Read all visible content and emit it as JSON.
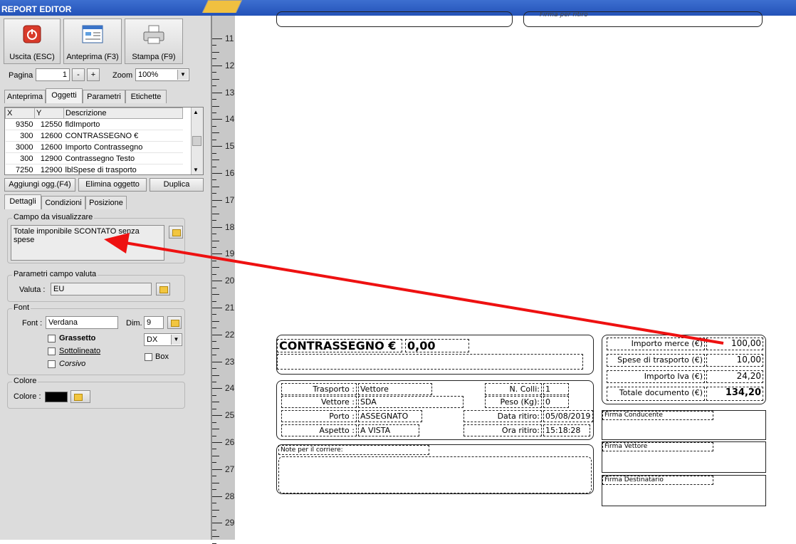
{
  "window": {
    "title": "REPORT EDITOR"
  },
  "toolbar": {
    "exit": "Uscita (ESC)",
    "preview": "Anteprima (F3)",
    "print": "Stampa (F9)"
  },
  "paging": {
    "page_label": "Pagina",
    "page_value": "1",
    "minus": "-",
    "plus": "+",
    "zoom_label": "Zoom",
    "zoom_value": "100%"
  },
  "top_tabs": [
    "Anteprima",
    "Oggetti",
    "Parametri",
    "Etichette"
  ],
  "grid": {
    "headers": [
      "X",
      "Y",
      "Descrizione"
    ],
    "rows": [
      {
        "x": "9350",
        "y": "12550",
        "desc": "fldImporto"
      },
      {
        "x": "300",
        "y": "12600",
        "desc": "CONTRASSEGNO €"
      },
      {
        "x": "3000",
        "y": "12600",
        "desc": "Importo Contrassegno"
      },
      {
        "x": "300",
        "y": "12900",
        "desc": "Contrassegno Testo"
      },
      {
        "x": "7250",
        "y": "12900",
        "desc": "lblSpese di trasporto"
      }
    ]
  },
  "object_buttons": {
    "add": "Aggiungi ogg.(F4)",
    "delete": "Elimina oggetto",
    "duplicate": "Duplica"
  },
  "detail_tabs": [
    "Dettagli",
    "Condizioni",
    "Posizione"
  ],
  "field_group": {
    "title": "Campo da visualizzare",
    "value": "Totale imponibile SCONTATO senza spese"
  },
  "currency_group": {
    "title": "Parametri campo valuta",
    "label": "Valuta :",
    "value": "EU"
  },
  "font_group": {
    "title": "Font",
    "font_label": "Font :",
    "font_value": "Verdana",
    "size_label": "Dim.",
    "size_value": "9",
    "bold": "Grassetto",
    "underline": "Sottolineato",
    "italic": "Corsivo",
    "align_value": "DX",
    "box": "Box"
  },
  "color_group": {
    "title": "Colore",
    "label": "Colore :",
    "value_color": "#000000"
  },
  "ruler": [
    "11",
    "12",
    "13",
    "14",
    "15",
    "16",
    "17",
    "18",
    "19",
    "20",
    "21",
    "22",
    "23",
    "24",
    "25",
    "26",
    "27",
    "28",
    "29"
  ],
  "report": {
    "top_partial": "Firma per ritiro",
    "contrassegno_label": "CONTRASSEGNO €",
    "contrassegno_value": "0,00",
    "totals": [
      {
        "label": "Importo merce (€)",
        "value": "100,00"
      },
      {
        "label": "Spese di trasporto (€)",
        "value": "10,00"
      },
      {
        "label": "Importo Iva (€)",
        "value": "24,20"
      },
      {
        "label": "Totale documento (€)",
        "value": "134,20"
      }
    ],
    "transport": {
      "trasporto_label": "Trasporto :",
      "trasporto_value": "Vettore",
      "vettore_label": "Vettore :",
      "vettore_value": "SDA",
      "porto_label": "Porto :",
      "porto_value": "ASSEGNATO",
      "aspetto_label": "Aspetto :",
      "aspetto_value": "A VISTA",
      "colli_label": "N. Colli:",
      "colli_value": "1",
      "peso_label": "Peso (Kg):",
      "peso_value": "0",
      "data_label": "Data ritiro:",
      "data_value": "05/08/2019",
      "ora_label": "Ora ritiro:",
      "ora_value": "15:18:28"
    },
    "note_label": "Note per il corriere:",
    "signatures": [
      "Firma Conducente",
      "Firma Vettore",
      "Firma Destinatario"
    ]
  },
  "colors": {
    "title_bar": "#2d5ec4",
    "arrow": "#ee1111",
    "exit_icon": "#d83a2a"
  }
}
